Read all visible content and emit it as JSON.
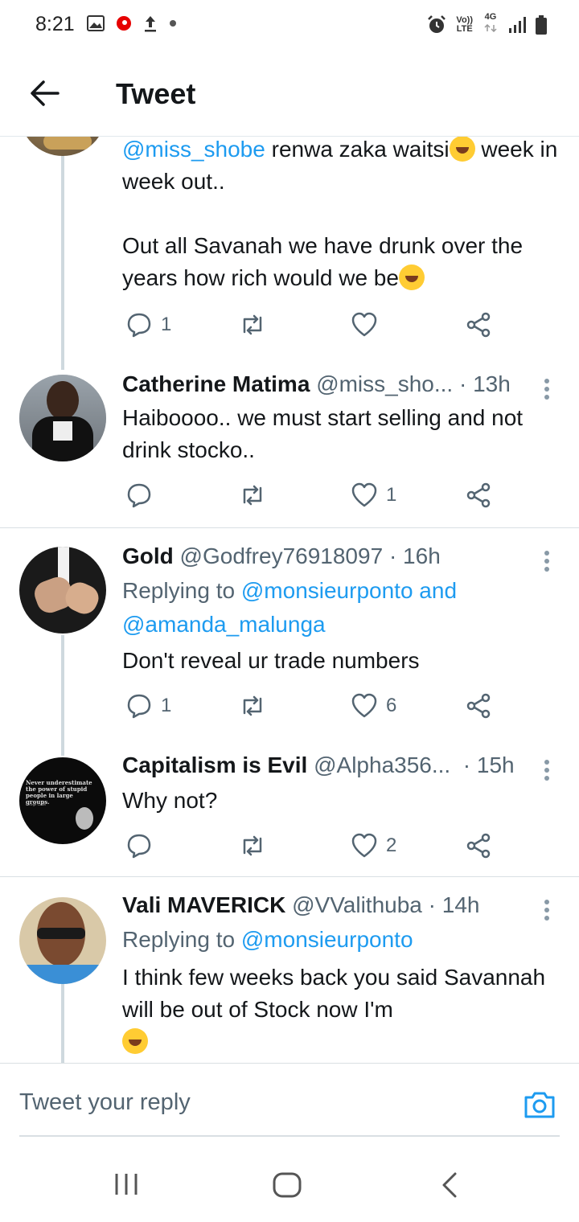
{
  "status_bar": {
    "time": "8:21",
    "volte_line1": "Vo))",
    "volte_line2": "LTE",
    "net_line1": "4G"
  },
  "header": {
    "title": "Tweet"
  },
  "tweets": [
    {
      "mention": "@miss_shobe",
      "text_line1_rest": " renwa zaka waitsi",
      "text_line1_after_emoji": " week in week out..",
      "text_line2_pre_emoji": "Out all Savanah we have drunk over the years how rich would we be",
      "reply_count": "1",
      "retweet_count": "",
      "like_count": ""
    },
    {
      "name": "Catherine Matima",
      "handle": "@miss_sho...",
      "time": "13h",
      "text": "Haiboooo.. we must start selling and not drink stocko..",
      "reply_count": "",
      "retweet_count": "",
      "like_count": "1"
    },
    {
      "name": "Gold",
      "handle": "@Godfrey76918097",
      "time": "16h",
      "replying_label": "Replying to ",
      "replying_to": "@monsieurponto and",
      "replying_to2": "@amanda_malunga",
      "text": "Don't reveal ur trade numbers",
      "reply_count": "1",
      "retweet_count": "",
      "like_count": "6"
    },
    {
      "name": "Capitalism is Evil",
      "handle": "@Alpha356...",
      "time": "15h",
      "avatar_quote": "Never underestimate the power of stupid people in large groups.",
      "avatar_author": "George Carlin",
      "text": "Why not?",
      "reply_count": "",
      "retweet_count": "",
      "like_count": "2"
    },
    {
      "name": "Vali MAVERICK",
      "handle": "@VValithuba",
      "time": "14h",
      "replying_label": "Replying to ",
      "replying_to": "@monsieurponto",
      "text": "I think few weeks back you said Savannah will be out of Stock now I'm"
    }
  ],
  "reply_bar": {
    "placeholder": "Tweet your reply"
  },
  "colors": {
    "accent": "#1d9bf0",
    "muted": "#536471",
    "text": "#14171a",
    "divider": "#d9dfe3"
  },
  "icons": {
    "back": "arrow-left-icon",
    "reply": "comment-icon",
    "retweet": "retweet-icon",
    "like": "heart-icon",
    "share": "share-icon",
    "more": "more-vertical-icon",
    "camera": "camera-icon"
  }
}
